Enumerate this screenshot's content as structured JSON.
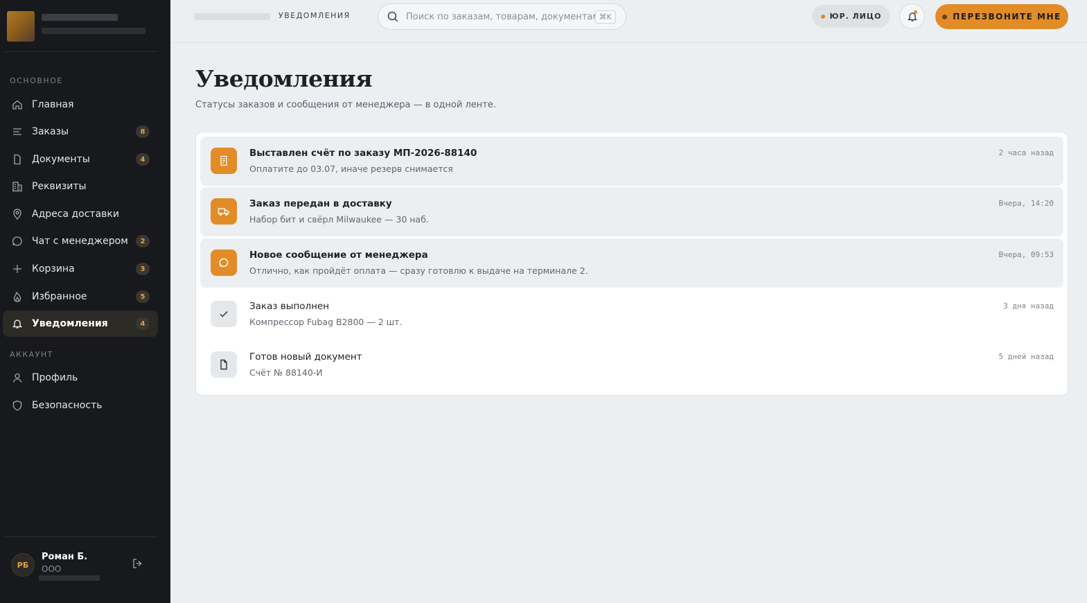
{
  "sidebar": {
    "sections": {
      "main": "ОСНОВНОЕ",
      "account": "АККАУНТ"
    },
    "items": [
      {
        "label": "Главная",
        "icon": "home-icon"
      },
      {
        "label": "Заказы",
        "icon": "list-icon",
        "badge": "8"
      },
      {
        "label": "Документы",
        "icon": "document-icon",
        "badge": "4"
      },
      {
        "label": "Реквизиты",
        "icon": "building-icon"
      },
      {
        "label": "Адреса доставки",
        "icon": "location-pin-icon"
      },
      {
        "label": "Чат с менеджером",
        "icon": "chat-icon",
        "badge": "2"
      },
      {
        "label": "Корзина",
        "icon": "plus-icon",
        "badge": "3"
      },
      {
        "label": "Избранное",
        "icon": "flame-icon",
        "badge": "5"
      },
      {
        "label": "Уведомления",
        "icon": "bell-icon",
        "badge": "4",
        "active": true
      }
    ],
    "account_items": [
      {
        "label": "Профиль",
        "icon": "user-icon"
      },
      {
        "label": "Безопасность",
        "icon": "shield-icon"
      }
    ],
    "user": {
      "initials": "РБ",
      "name": "Роман Б.",
      "org": "ООО"
    }
  },
  "topbar": {
    "breadcrumb": "УВЕДОМЛЕНИЯ",
    "search_placeholder": "Поиск по заказам, товарам, документам...",
    "search_shortcut": "⌘K",
    "entity_pill": "ЮР. ЛИЦО",
    "cta": "ПЕРЕЗВОНИТЕ МНЕ"
  },
  "main": {
    "title": "Уведомления",
    "subtitle": "Статусы заказов и сообщения от менеджера — в одной ленте.",
    "notifications": [
      {
        "title": "Выставлен счёт по заказу МП-2026-88140",
        "desc": "Оплатите до 03.07, иначе резерв снимается",
        "time": "2 часа назад",
        "unread": true,
        "icon": "invoice-icon"
      },
      {
        "title": "Заказ передан в доставку",
        "desc": "Набор бит и свёрл Milwaukee — 30 наб.",
        "time": "Вчера, 14:20",
        "unread": true,
        "icon": "truck-icon"
      },
      {
        "title": "Новое сообщение от менеджера",
        "desc": "Отлично, как пройдёт оплата — сразу готовлю к выдаче на терминале 2.",
        "time": "Вчера, 09:53",
        "unread": true,
        "icon": "chat-icon"
      },
      {
        "title": "Заказ выполнен",
        "desc": "Компрессор Fubag B2800 — 2 шт.",
        "time": "3 дня назад",
        "unread": false,
        "icon": "check-icon"
      },
      {
        "title": "Готов новый документ",
        "desc": "Счёт № 88140-И",
        "time": "5 дней назад",
        "unread": false,
        "icon": "document-icon"
      }
    ]
  },
  "colors": {
    "accent": "#e28c27",
    "sidebar_bg": "#17191d",
    "page_bg": "#eceff2"
  }
}
